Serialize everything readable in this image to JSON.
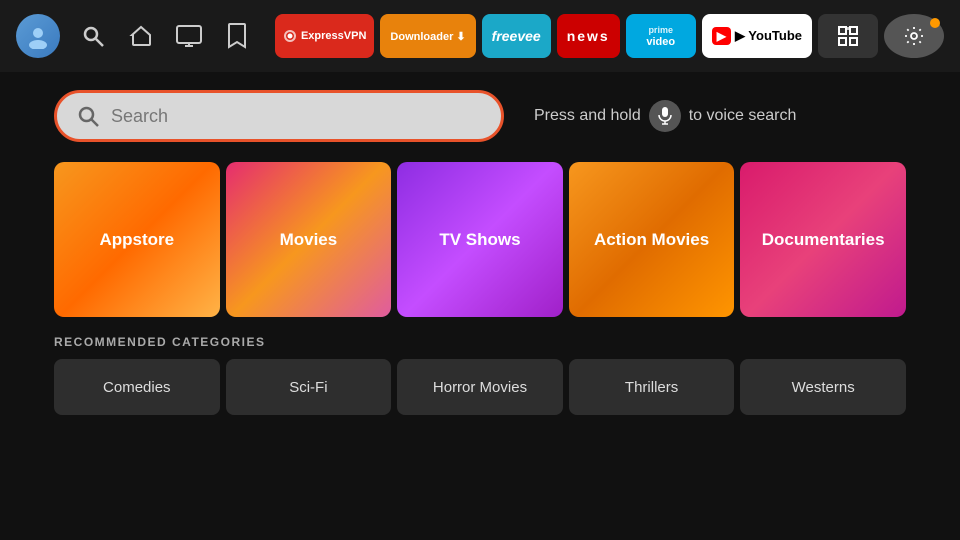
{
  "nav": {
    "avatar_label": "👤",
    "icons": [
      {
        "name": "search-icon",
        "symbol": "🔍"
      },
      {
        "name": "home-icon",
        "symbol": "⌂"
      },
      {
        "name": "tv-icon",
        "symbol": "📺"
      },
      {
        "name": "bookmark-icon",
        "symbol": "🔖"
      }
    ],
    "apps": [
      {
        "id": "expressvpn",
        "label": "ExpressVPN",
        "class": "badge-expressvpn"
      },
      {
        "id": "downloader",
        "label": "Downloader ⬇",
        "class": "badge-downloader"
      },
      {
        "id": "freevee",
        "label": "freevee",
        "class": "badge-freevee"
      },
      {
        "id": "news",
        "label": "news",
        "class": "badge-news"
      },
      {
        "id": "primevideo",
        "label": "prime video",
        "class": "badge-primevideo"
      },
      {
        "id": "youtube",
        "label": "▶ YouTube",
        "class": "badge-youtube"
      },
      {
        "id": "grid",
        "label": "⊞",
        "class": "badge-grid"
      },
      {
        "id": "settings",
        "label": "⚙",
        "class": "badge-settings"
      }
    ]
  },
  "search": {
    "placeholder": "Search",
    "voice_hint_prefix": "Press and hold",
    "voice_hint_suffix": "to voice search"
  },
  "category_tiles": [
    {
      "id": "appstore",
      "label": "Appstore",
      "class": "tile-appstore"
    },
    {
      "id": "movies",
      "label": "Movies",
      "class": "tile-movies"
    },
    {
      "id": "tvshows",
      "label": "TV Shows",
      "class": "tile-tvshows"
    },
    {
      "id": "action",
      "label": "Action Movies",
      "class": "tile-action"
    },
    {
      "id": "documentaries",
      "label": "Documentaries",
      "class": "tile-documentaries"
    }
  ],
  "recommended": {
    "section_label": "RECOMMENDED CATEGORIES",
    "items": [
      {
        "id": "comedies",
        "label": "Comedies"
      },
      {
        "id": "scifi",
        "label": "Sci-Fi"
      },
      {
        "id": "horror",
        "label": "Horror Movies"
      },
      {
        "id": "thrillers",
        "label": "Thrillers"
      },
      {
        "id": "westerns",
        "label": "Westerns"
      }
    ]
  }
}
